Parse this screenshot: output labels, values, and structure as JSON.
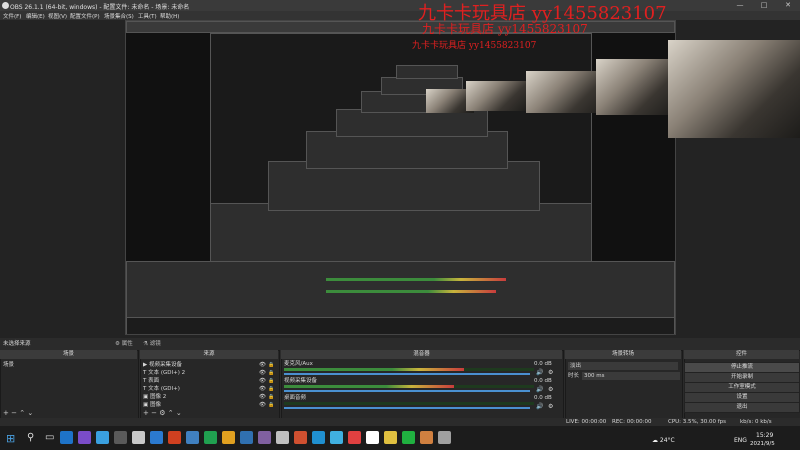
{
  "window": {
    "title": "OBS 26.1.1 (64-bit, windows) - 配置文件: 未命名 - 场景: 未命名",
    "minimize": "—",
    "maximize": "□",
    "close": "✕"
  },
  "menu": [
    "文件(F)",
    "编辑(E)",
    "视图(V)",
    "配置文件(P)",
    "场景集合(S)",
    "工具(T)",
    "帮助(H)"
  ],
  "watermark": {
    "line1": "九卡卡玩具店   yy1455823107",
    "line2": "九卡卡玩具店  yy1455823107",
    "line3": "九卡卡玩具店  yy1455823107"
  },
  "docks": {
    "no_source": "未选择来源",
    "properties": "属性",
    "filters": "滤镜",
    "scenes": {
      "header": "场景",
      "items": [
        "场景"
      ]
    },
    "sources": {
      "header": "来源",
      "items": [
        {
          "icon": "video-capture-icon",
          "label": "视频采集设备"
        },
        {
          "icon": "text-icon",
          "label": "文本 (GDI+) 2"
        },
        {
          "icon": "text-icon",
          "label": "表面"
        },
        {
          "icon": "text-icon",
          "label": "文本 (GDI+)"
        },
        {
          "icon": "image-icon",
          "label": "图像 2"
        },
        {
          "icon": "image-icon",
          "label": "图像"
        }
      ]
    },
    "mixer": {
      "header": "混音器",
      "channels": [
        {
          "name": "麦克风/Aux",
          "db": "0.0 dB",
          "level": 0.72
        },
        {
          "name": "视频采集设备",
          "db": "0.0 dB",
          "level": 0.68
        },
        {
          "name": "桌面音频",
          "db": "0.0 dB",
          "level": 0.0
        }
      ]
    },
    "transitions": {
      "header": "场景转场",
      "type": "淡出",
      "duration_label": "时长",
      "duration": "300 ms"
    },
    "controls": {
      "header": "控件",
      "buttons": [
        "停止推流",
        "开始录制",
        "工作室模式",
        "设置",
        "退出"
      ]
    }
  },
  "status": {
    "live": "LIVE: 00:00:00",
    "rec": "REC: 00:00:00",
    "cpu": "CPU: 3.5%, 30.00 fps",
    "kbps": "kb/s: 0 kb/s"
  },
  "taskbar": {
    "weather": "24°C",
    "ime": "ENG",
    "time": "15:29",
    "date": "2021/9/5",
    "icon_colors": [
      "#1e73c8",
      "#7a4cc8",
      "#3aa0e0",
      "#5a5a5a",
      "#c8c8c8",
      "#2b7ad0",
      "#d04020",
      "#4080c0",
      "#20a050",
      "#e0a020",
      "#3070b0",
      "#8060a0",
      "#c0c0c0",
      "#d05030",
      "#2090d0",
      "#40b0e0",
      "#e04040",
      "#ffffff",
      "#e0c040",
      "#20b040",
      "#d08040",
      "#a0a0a0"
    ]
  }
}
